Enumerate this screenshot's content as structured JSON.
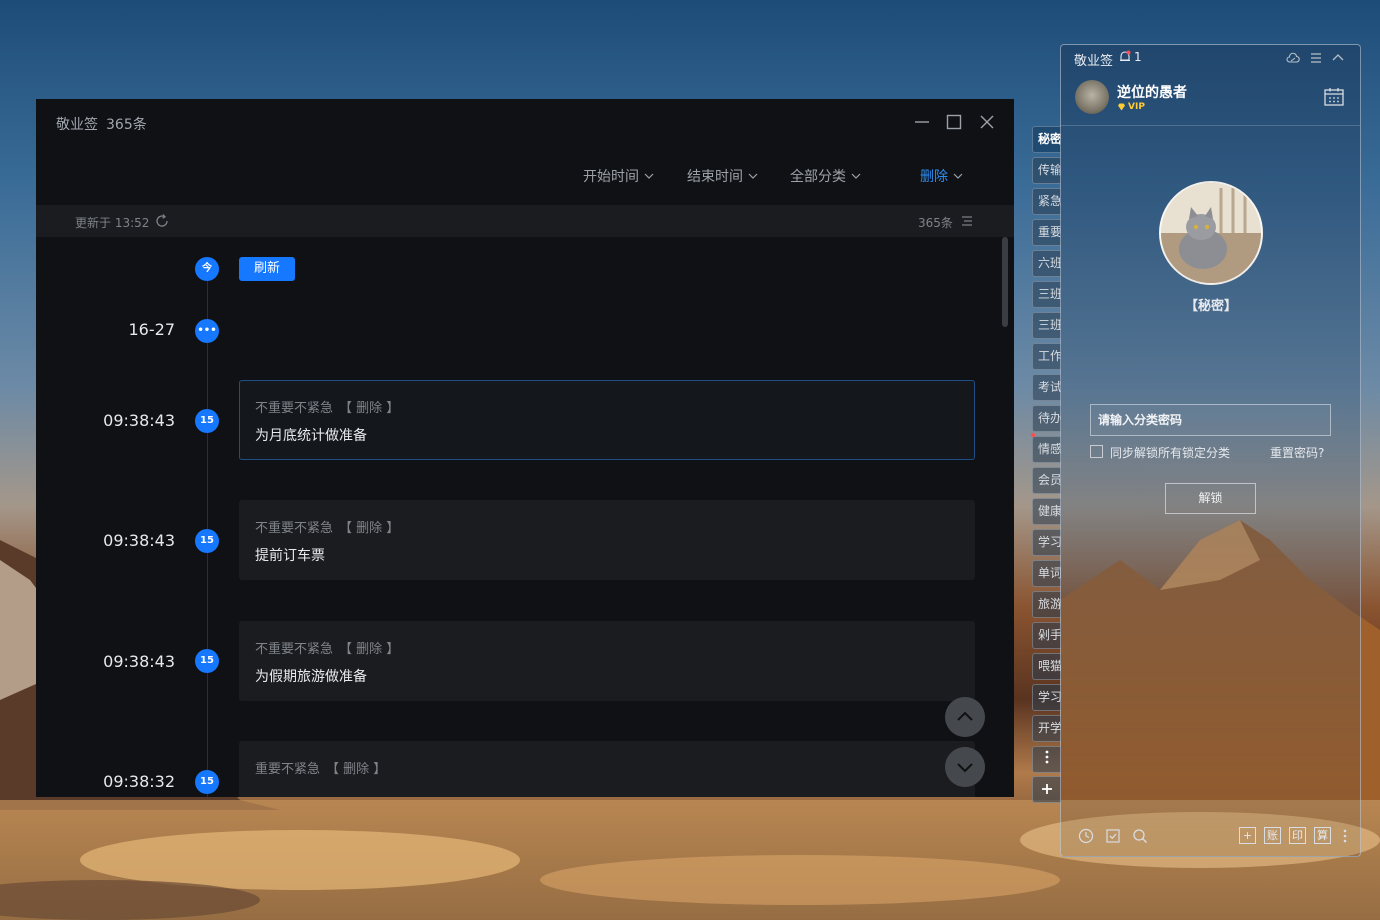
{
  "main_window": {
    "title": "敬业签",
    "count": "365条",
    "filters": {
      "start_time": "开始时间",
      "end_time": "结束时间",
      "category": "全部分类",
      "delete": "删除"
    },
    "update": {
      "text": "更新于 13:52",
      "count": "365条"
    },
    "timeline": {
      "today_badge": "今",
      "refresh_button": "刷新",
      "date_group": "16-27",
      "more_badge": "•••"
    },
    "items": [
      {
        "time": "09:38:43",
        "badge": "15",
        "category": "不重要不紧急",
        "delete_label": "【 删除 】",
        "content": "为月底统计做准备"
      },
      {
        "time": "09:38:43",
        "badge": "15",
        "category": "不重要不紧急",
        "delete_label": "【 删除 】",
        "content": "提前订车票"
      },
      {
        "time": "09:38:43",
        "badge": "15",
        "category": "不重要不紧急",
        "delete_label": "【 删除 】",
        "content": "为假期旅游做准备"
      },
      {
        "time": "09:38:32",
        "badge": "15",
        "category": "重要不紧急",
        "delete_label": "【 删除 】",
        "content": ""
      }
    ]
  },
  "side_panel": {
    "title": "敬业签",
    "notification_count": "1",
    "username": "逆位的愚者",
    "vip": "VIP",
    "secret_label": "【秘密】",
    "password_placeholder": "请输入分类密码",
    "sync_label": "同步解锁所有锁定分类",
    "reset_link": "重置密码?",
    "unlock_button": "解锁",
    "tabs": [
      "秘密",
      "传输",
      "紧急",
      "重要",
      "六班",
      "三班",
      "三班",
      "工作",
      "考试",
      "待办",
      "情感",
      "会员",
      "健康",
      "学习",
      "单词",
      "旅游",
      "剁手",
      "喂猫",
      "学习",
      "开学"
    ],
    "bottom_boxes": [
      "+",
      "账",
      "印",
      "算"
    ]
  }
}
